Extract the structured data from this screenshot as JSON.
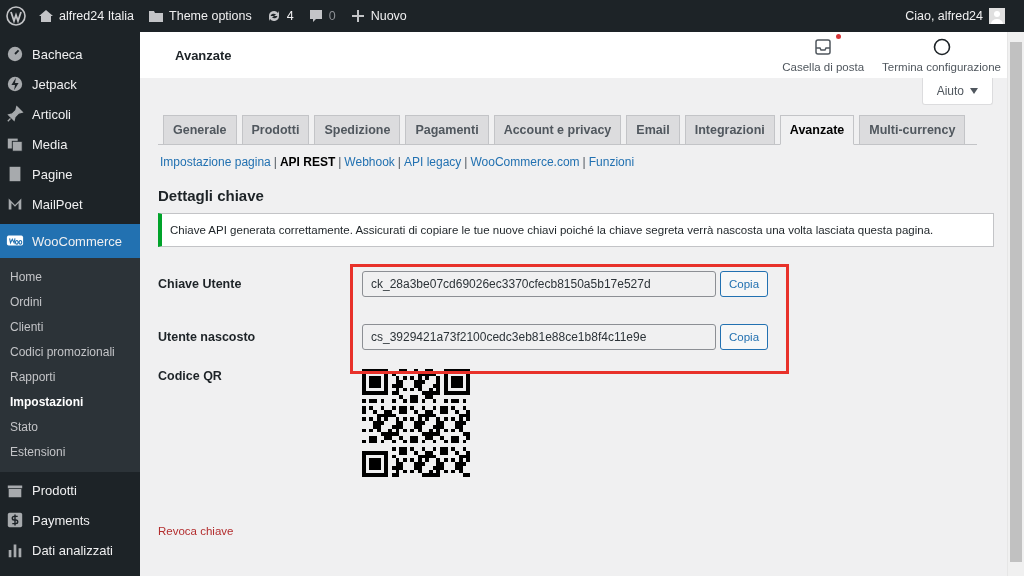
{
  "admin_bar": {
    "site": "alfred24 Italia",
    "theme": "Theme options",
    "updates": "4",
    "comments": "0",
    "new": "Nuovo",
    "greeting": "Ciao, alfred24"
  },
  "sidebar": {
    "items": [
      {
        "label": "Bacheca",
        "kind": "main",
        "selected": false
      },
      {
        "label": "Jetpack",
        "kind": "main",
        "selected": false
      },
      {
        "label": "Articoli",
        "kind": "main",
        "selected": false
      },
      {
        "label": "Media",
        "kind": "main",
        "selected": false
      },
      {
        "label": "Pagine",
        "kind": "main",
        "selected": false
      },
      {
        "label": "MailPoet",
        "kind": "main",
        "selected": false
      },
      {
        "label": "WooCommerce",
        "kind": "main",
        "selected": true
      },
      {
        "label": "Home",
        "kind": "sub",
        "selected": false
      },
      {
        "label": "Ordini",
        "kind": "sub",
        "selected": false
      },
      {
        "label": "Clienti",
        "kind": "sub",
        "selected": false
      },
      {
        "label": "Codici promozionali",
        "kind": "sub",
        "selected": false
      },
      {
        "label": "Rapporti",
        "kind": "sub",
        "selected": false
      },
      {
        "label": "Impostazioni",
        "kind": "sub",
        "selected": true
      },
      {
        "label": "Stato",
        "kind": "sub",
        "selected": false
      },
      {
        "label": "Estensioni",
        "kind": "sub",
        "selected": false
      },
      {
        "label": "Prodotti",
        "kind": "main",
        "selected": false
      },
      {
        "label": "Payments",
        "kind": "main",
        "selected": false
      },
      {
        "label": "Dati analizzati",
        "kind": "main",
        "selected": false
      }
    ]
  },
  "header": {
    "title": "Avanzate",
    "actions": [
      {
        "label": "Casella di posta",
        "unread": true
      },
      {
        "label": "Termina configurazione",
        "unread": false
      }
    ]
  },
  "help_button": "Aiuto",
  "tabs": [
    {
      "label": "Generale",
      "selected": false
    },
    {
      "label": "Prodotti",
      "selected": false
    },
    {
      "label": "Spedizione",
      "selected": false
    },
    {
      "label": "Pagamenti",
      "selected": false
    },
    {
      "label": "Account e privacy",
      "selected": false
    },
    {
      "label": "Email",
      "selected": false
    },
    {
      "label": "Integrazioni",
      "selected": false
    },
    {
      "label": "Avanzate",
      "selected": true
    },
    {
      "label": "Multi-currency",
      "selected": false
    }
  ],
  "subnav": [
    {
      "label": "Impostazione pagina",
      "selected": false
    },
    {
      "separator": "|",
      "label": "API REST",
      "selected": true
    },
    {
      "separator": "|",
      "label": "Webhook",
      "selected": false
    },
    {
      "separator": "|",
      "label": "API legacy",
      "selected": false
    },
    {
      "separator": "|",
      "label": "WooCommerce.com",
      "selected": false
    },
    {
      "separator": "|",
      "label": "Funzioni",
      "selected": false
    }
  ],
  "heading": "Dettagli chiave",
  "notice": "Chiave API generata correttamente. Assicurati di copiare le tue nuove chiavi poiché la chiave segreta verrà nascosta una volta lasciata questa pagina.",
  "fields": [
    {
      "label": "Chiave Utente",
      "value": "ck_28a3be07cd69026ec3370cfecb8150a5b17e527d",
      "button": "Copia"
    },
    {
      "label": "Utente nascosto",
      "value": "cs_3929421a73f2100cedc3eb81e88ce1b8f4c11e9e",
      "button": "Copia"
    }
  ],
  "qr_label": "Codice QR",
  "revoke_link": "Revoca chiave"
}
